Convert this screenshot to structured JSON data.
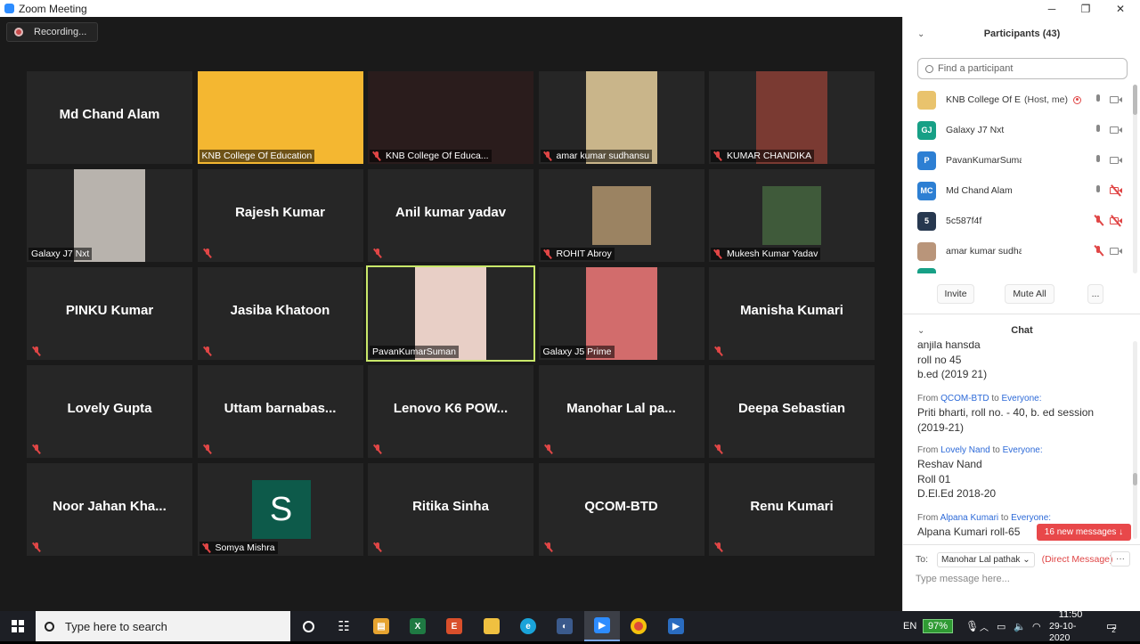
{
  "window": {
    "title": "Zoom Meeting",
    "minimize": "─",
    "maximize": "❐",
    "close": "✕"
  },
  "recording": {
    "label": "Recording..."
  },
  "tiles": [
    {
      "name": "Md Chand Alam",
      "label": "",
      "muted": false,
      "video": false
    },
    {
      "name": "",
      "label": "KNB College Of Education",
      "muted": false,
      "video": true,
      "bg": "#f4b731"
    },
    {
      "name": "",
      "label": "KNB College Of Educa...",
      "muted": true,
      "video": true,
      "bg": "#2a1c1c"
    },
    {
      "name": "",
      "label": "amar kumar sudhansu",
      "muted": true,
      "video": true,
      "bg": "#c9b58a"
    },
    {
      "name": "",
      "label": "KUMAR CHANDIKA",
      "muted": true,
      "video": true,
      "bg": "#7a3a32"
    },
    {
      "name": "",
      "label": "Galaxy J7 Nxt",
      "muted": false,
      "video": true,
      "bg": "#b8b3ad"
    },
    {
      "name": "Rajesh Kumar",
      "label": "",
      "muted": true,
      "video": false
    },
    {
      "name": "Anil kumar yadav",
      "label": "",
      "muted": true,
      "video": false
    },
    {
      "name": "",
      "label": "ROHIT Abroy",
      "muted": true,
      "video": true,
      "bg": "#9b8362"
    },
    {
      "name": "",
      "label": "Mukesh Kumar Yadav",
      "muted": true,
      "video": true,
      "bg": "#3f5a3a"
    },
    {
      "name": "PINKU Kumar",
      "label": "",
      "muted": true,
      "video": false
    },
    {
      "name": "Jasiba Khatoon",
      "label": "",
      "muted": true,
      "video": false
    },
    {
      "name": "",
      "label": "PavanKumarSuman",
      "muted": false,
      "video": true,
      "bg": "#e8cfc6",
      "highlight": true
    },
    {
      "name": "",
      "label": "Galaxy J5 Prime",
      "muted": false,
      "video": true,
      "bg": "#d26c6c"
    },
    {
      "name": "Manisha Kumari",
      "label": "",
      "muted": true,
      "video": false
    },
    {
      "name": "Lovely Gupta",
      "label": "",
      "muted": true,
      "video": false
    },
    {
      "name": "Uttam  barnabas...",
      "label": "",
      "muted": true,
      "video": false
    },
    {
      "name": "Lenovo K6 POW...",
      "label": "",
      "muted": true,
      "video": false
    },
    {
      "name": "Manohar Lal pa...",
      "label": "",
      "muted": true,
      "video": false
    },
    {
      "name": "Deepa Sebastian",
      "label": "",
      "muted": true,
      "video": false
    },
    {
      "name": "Noor Jahan Kha...",
      "label": "",
      "muted": true,
      "video": false
    },
    {
      "name": "",
      "label": "Somya Mishra",
      "muted": true,
      "video": false,
      "avatar": "S"
    },
    {
      "name": "Ritika Sinha",
      "label": "",
      "muted": true,
      "video": false
    },
    {
      "name": "QCOM-BTD",
      "label": "",
      "muted": true,
      "video": false
    },
    {
      "name": "Renu Kumari",
      "label": "",
      "muted": true,
      "video": false
    }
  ],
  "participants": {
    "header": "Participants (43)",
    "search_placeholder": "Find a participant",
    "list": [
      {
        "initials": "",
        "name": "KNB College Of E...",
        "role": "(Host, me)",
        "color": "#e9c36d",
        "mic": "on",
        "cam": "on",
        "rec": true
      },
      {
        "initials": "GJ",
        "name": "Galaxy J7 Nxt",
        "role": "",
        "color": "#17a086",
        "mic": "on",
        "cam": "on"
      },
      {
        "initials": "P",
        "name": "PavanKumarSuman",
        "role": "",
        "color": "#2d7fd3",
        "mic": "on",
        "cam": "on"
      },
      {
        "initials": "MC",
        "name": "Md Chand Alam",
        "role": "",
        "color": "#2d7fd3",
        "mic": "on",
        "cam": "off"
      },
      {
        "initials": "5",
        "name": "5c587f4f",
        "role": "",
        "color": "#27384f",
        "mic": "off",
        "cam": "off"
      },
      {
        "initials": "",
        "name": "amar kumar sudhansu",
        "role": "",
        "color": "#b9957a",
        "mic": "off",
        "cam": "on"
      }
    ],
    "invite": "Invite",
    "mute_all": "Mute All",
    "more": "..."
  },
  "chat": {
    "header": "Chat",
    "messages": [
      {
        "from": "",
        "to": "",
        "lines": [
          "anjila hansda",
          "roll no 45",
          "b.ed (2019 21)"
        ]
      },
      {
        "from": "QCOM-BTD",
        "to": "Everyone:",
        "lines": [
          "Priti bharti, roll no. - 40, b. ed session",
          "(2019-21)"
        ]
      },
      {
        "from": "Lovely Nand",
        "to": "Everyone:",
        "lines": [
          "Reshav Nand",
          "Roll 01",
          "D.El.Ed 2018-20"
        ]
      },
      {
        "from": "Alpana Kumari",
        "to": "Everyone:",
        "lines": [
          "Alpana Kumari roll-65"
        ]
      }
    ],
    "from_word": "From",
    "to_word": "to",
    "new_messages": "16 new messages ↓",
    "to_label": "To:",
    "to_recipient": "Manohar Lal pathak ⌄",
    "direct": "(Direct Message)",
    "more": "···",
    "placeholder": "Type message here..."
  },
  "taskbar": {
    "search": "Type here to search",
    "lang": "EN",
    "battery": "97%",
    "time": "11:50",
    "date": "29-10-2020",
    "notif_count": "2"
  }
}
